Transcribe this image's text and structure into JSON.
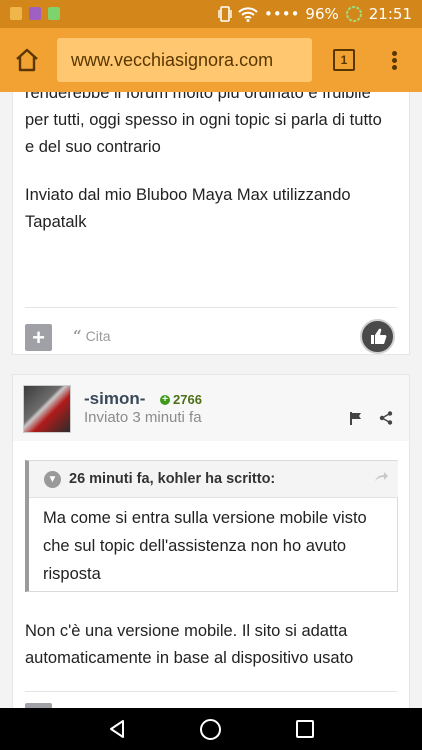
{
  "status_bar": {
    "battery": "96%",
    "time": "21:51",
    "signal_dots": "••••",
    "app_colors": [
      "#f0b64a",
      "#9f5fc3",
      "#7ed36c"
    ]
  },
  "browser": {
    "url": "www.vecchiasignora.com",
    "tab_count": "1"
  },
  "post1": {
    "text_lines": "renderebbe il forum molto più ordinato e fruibile per tutti, oggi spesso in ogni topic si parla di tutto e del suo contrario",
    "signature": "Inviato dal mio Bluboo Maya Max utilizzando Tapatalk",
    "quote_label": "Cita"
  },
  "post2": {
    "author": "-simon-",
    "reputation": "2766",
    "posted": "Inviato 3 minuti fa",
    "quote_header": "26 minuti fa, kohler ha scritto:",
    "quote_text": "Ma come si entra sulla versione mobile visto che sul topic dell'assistenza non ho avuto risposta",
    "body": "Non c'è una versione mobile. Il sito si adatta automaticamente in base al dispositivo usato"
  },
  "colors": {
    "status_bar": "#d3871b",
    "url_bar": "#f2a232",
    "url_box": "#ffc76f",
    "accent_text": "#5a3700"
  }
}
